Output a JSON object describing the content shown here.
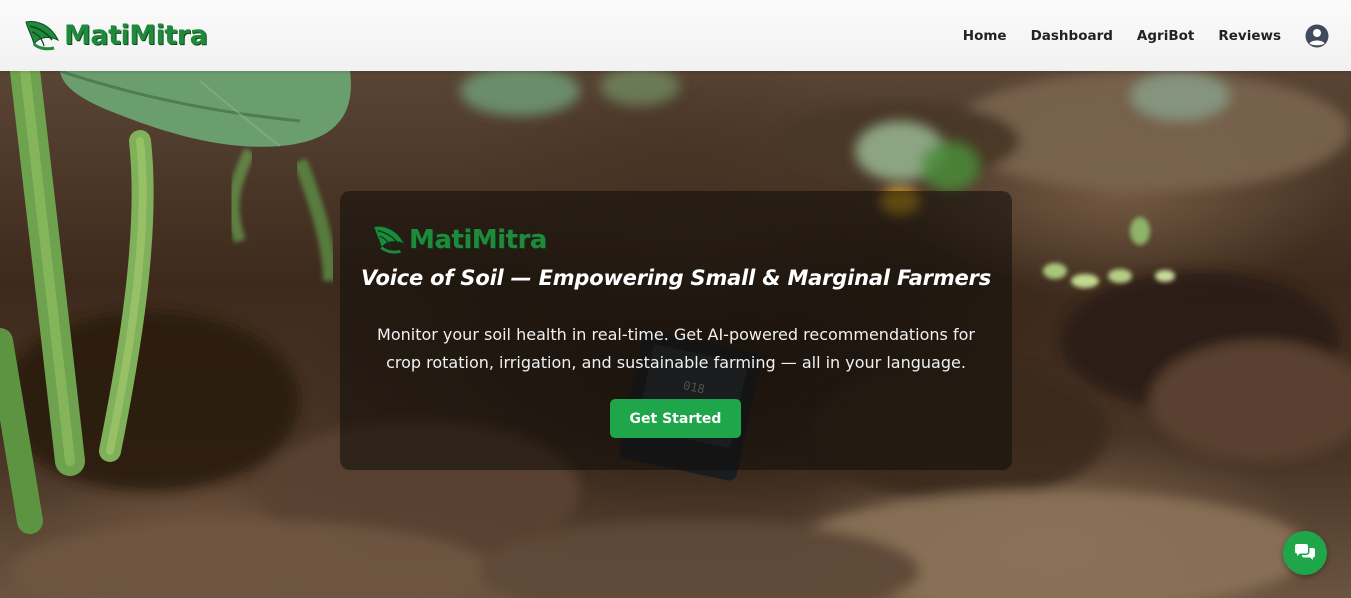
{
  "brand": {
    "name": "MatiMitra"
  },
  "nav": {
    "items": [
      {
        "label": "Home"
      },
      {
        "label": "Dashboard"
      },
      {
        "label": "AgriBot"
      },
      {
        "label": "Reviews"
      }
    ],
    "profile_icon": "user-circle-icon"
  },
  "hero": {
    "brand_name": "MatiMitra",
    "title": "Voice of Soil — Empowering Small & Marginal Farmers",
    "description": "Monitor your soil health in real-time. Get AI-powered recommendations for crop rotation, irrigation, and sustainable farming — all in your language.",
    "cta_label": "Get Started"
  },
  "chat": {
    "icon": "chat-bubbles-icon"
  },
  "colors": {
    "brand_green": "#1f8a3c",
    "button_green": "#1fa64a",
    "navbar_bg": "#f5f5f5"
  }
}
